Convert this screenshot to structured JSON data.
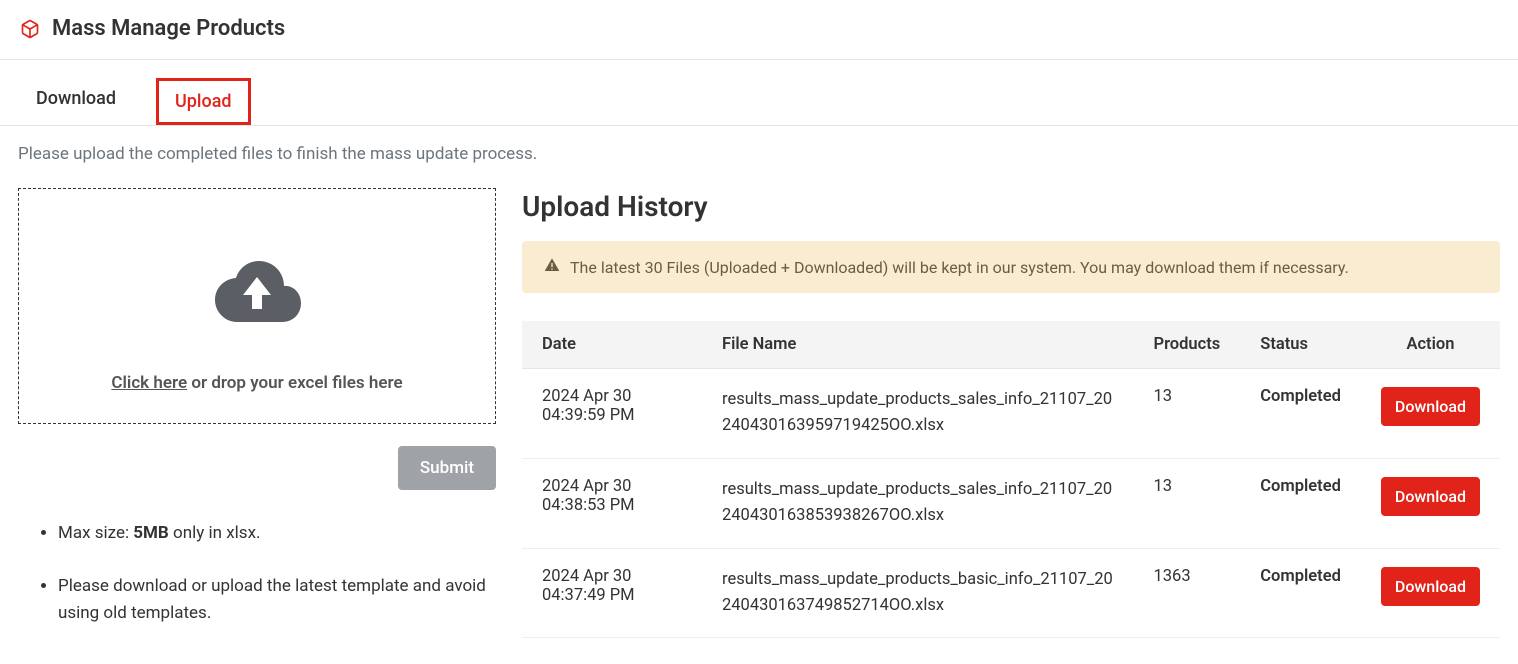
{
  "header": {
    "title": "Mass Manage Products"
  },
  "tabs": {
    "download": "Download",
    "upload": "Upload"
  },
  "instruction": "Please upload the completed files to finish the mass update process.",
  "dropzone": {
    "click_here": "Click here",
    "rest": " or drop your excel files here"
  },
  "submit_label": "Submit",
  "notes": {
    "n1_prefix": "Max size: ",
    "n1_bold": "5MB",
    "n1_suffix": " only in xlsx.",
    "n2": "Please download or upload the latest template and avoid using old templates."
  },
  "history": {
    "title": "Upload History",
    "alert": "The latest 30 Files (Uploaded + Downloaded) will be kept in our system. You may download them if necessary.",
    "cols": {
      "date": "Date",
      "file": "File Name",
      "products": "Products",
      "status": "Status",
      "action": "Action"
    },
    "download_label": "Download",
    "rows": [
      {
        "date": "2024 Apr 30 04:39:59 PM",
        "file": "results_mass_update_products_sales_info_21107_20240430163959719425OO.xlsx",
        "products": "13",
        "status": "Completed"
      },
      {
        "date": "2024 Apr 30 04:38:53 PM",
        "file": "results_mass_update_products_sales_info_21107_20240430163853938267OO.xlsx",
        "products": "13",
        "status": "Completed"
      },
      {
        "date": "2024 Apr 30 04:37:49 PM",
        "file": "results_mass_update_products_basic_info_21107_20240430163749852714OO.xlsx",
        "products": "1363",
        "status": "Completed"
      }
    ]
  }
}
